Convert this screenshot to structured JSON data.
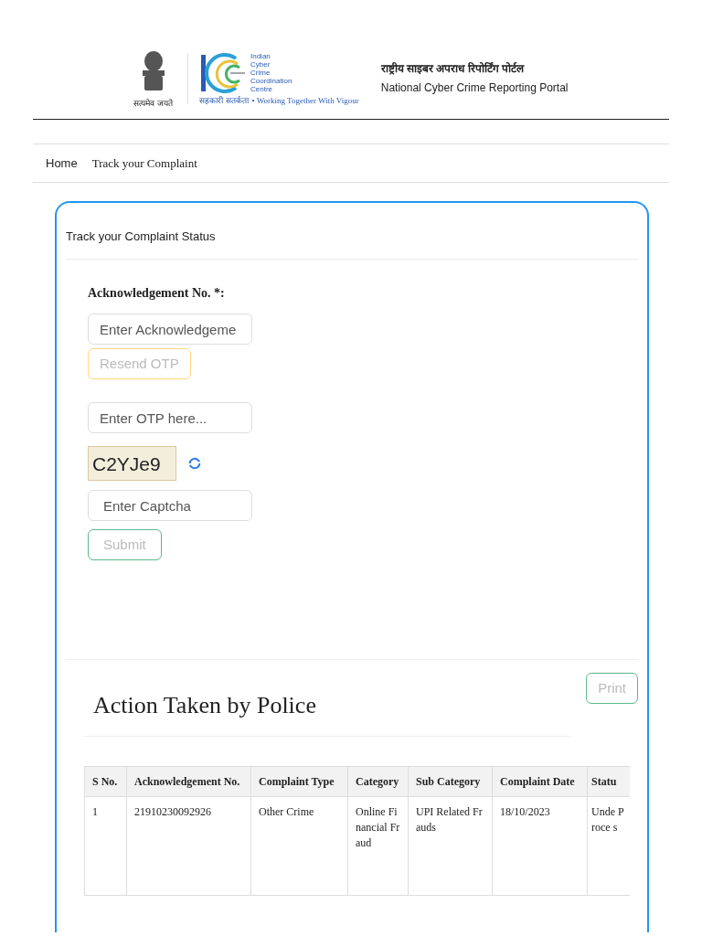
{
  "header": {
    "emblem_motto": "सत्यमेव जयते",
    "logo_lines": [
      "Indian",
      "Cyber",
      "Crime",
      "Coordination",
      "Centre"
    ],
    "logo_tagline_hindi": "सहकारी सतर्कता",
    "logo_tagline": "• Working Together With Vigour",
    "title_hindi": "राष्ट्रीय साइबर अपराध रिपोर्टिंग पोर्टल",
    "title": "National Cyber Crime Reporting Portal"
  },
  "breadcrumb": [
    "Home",
    "Track your Complaint"
  ],
  "card": {
    "title": "Track your Complaint Status",
    "ack_label": "Acknowledgement No. *:",
    "ack_placeholder": "Enter Acknowledgeme",
    "resend_button": "Resend OTP",
    "otp_placeholder": "Enter OTP here...",
    "captcha_text": "C2YJe9",
    "captcha_placeholder": "Enter Captcha",
    "submit_button": "Submit",
    "print_button": "Print",
    "section_title": "Action Taken by Police",
    "table": {
      "columns": [
        "S No.",
        "Acknowledgement No.",
        "Complaint Type",
        "Category",
        "Sub Category",
        "Complaint Date",
        "Statu"
      ],
      "rows": [
        [
          "1",
          "21910230092926",
          "Other Crime",
          "Online Financial Fraud",
          "UPI Related Frauds",
          "18/10/2023",
          "Unde Proce s"
        ]
      ]
    }
  }
}
